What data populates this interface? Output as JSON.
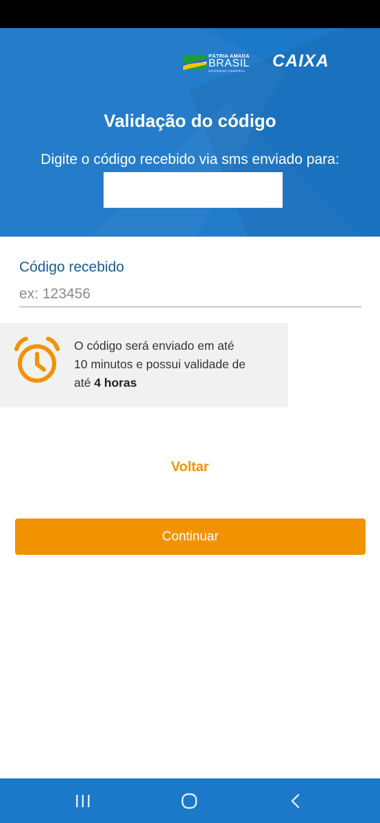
{
  "header": {
    "gov_logo": {
      "line1": "PÁTRIA AMADA",
      "line2": "BRASIL",
      "line3": "GOVERNO FEDERAL"
    },
    "brand": "CAIXA",
    "title": "Validação do código",
    "subtitle": "Digite o código recebido via sms enviado para:",
    "phone_value": ""
  },
  "form": {
    "code_label": "Código recebido",
    "code_placeholder": "ex: 123456",
    "code_value": ""
  },
  "info": {
    "icon": "alarm-clock-icon",
    "text_line1": "O código será enviado em até",
    "text_line2": "10 minutos e possui validade de",
    "text_line3_prefix": "até ",
    "text_line3_bold": "4 horas"
  },
  "actions": {
    "back_label": "Voltar",
    "continue_label": "Continuar"
  },
  "nav": {
    "recent_icon": "recent-apps-icon",
    "home_icon": "home-icon",
    "back_icon": "back-icon"
  },
  "colors": {
    "header_blue": "#1c78c9",
    "accent_orange": "#f39200",
    "label_blue": "#1c5b94",
    "info_bg": "#f1f1f1"
  }
}
